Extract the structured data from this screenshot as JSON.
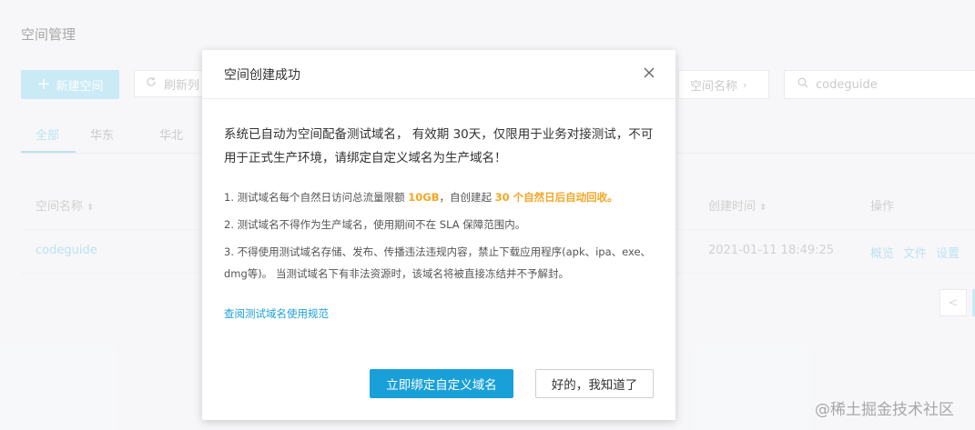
{
  "page": {
    "title": "空间管理",
    "new_button": "新建空间",
    "refresh_button": "刷新列",
    "filter_select": "空间名称",
    "search_value": "codeguide",
    "tabs": [
      "全部",
      "华东",
      "华北"
    ],
    "columns": {
      "name": "空间名称",
      "created": "创建时间",
      "actions": "操作"
    },
    "row": {
      "name": "codeguide",
      "created": "2021-01-11 18:49:25",
      "actions": [
        "概览",
        "文件",
        "设置"
      ]
    },
    "pager_prev": "<"
  },
  "modal": {
    "title": "空间创建成功",
    "lead": "系统已自动为空间配备测试域名， 有效期 30天，仅限用于业务对接测试，不可用于正式生产环境，请绑定自定义域名为生产域名！",
    "rule1_prefix": "1. 测试域名每个自然日访问总流量限额 ",
    "rule1_limit": "10GB",
    "rule1_mid": "，自创建起 ",
    "rule1_expire": "30 个自然日后自动回收。",
    "rule2": "2. 测试域名不得作为生产域名，使用期间不在 SLA 保障范围内。",
    "rule3": "3. 不得使用测试域名存储、发布、传播违法违规内容，禁止下载应用程序(apk、ipa、exe、dmg等)。 当测试域名下有非法资源时，该域名将被直接冻结并不予解封。",
    "rules_link": "查阅测试域名使用规范",
    "primary_button": "立即绑定自定义域名",
    "secondary_button": "好的，我知道了"
  },
  "watermark": "@稀土掘金技术社区",
  "colors": {
    "primary": "#1aa0d8",
    "highlight": "#f5a623"
  }
}
